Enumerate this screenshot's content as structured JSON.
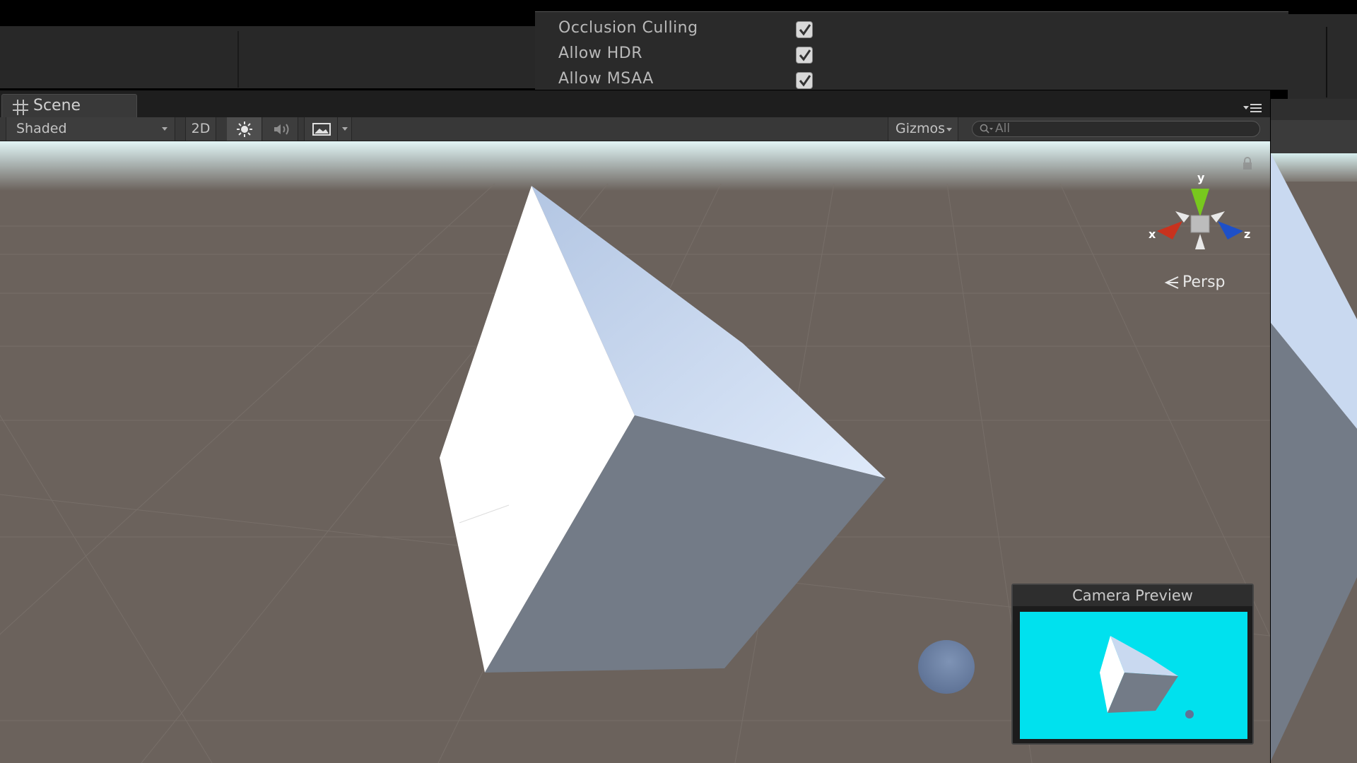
{
  "camera_settings": {
    "rows": [
      {
        "label": "Occlusion Culling",
        "checked": true
      },
      {
        "label": "Allow HDR",
        "checked": true
      },
      {
        "label": "Allow MSAA",
        "checked": true
      }
    ]
  },
  "scene_window": {
    "tab_label": "Scene",
    "toolbar": {
      "shading_mode": "Shaded",
      "toggle_2d": "2D",
      "lighting_on": true,
      "gizmos_label": "Gizmos",
      "search_placeholder": "All"
    },
    "view": {
      "projection_label": "Persp",
      "axis_labels": {
        "x": "x",
        "y": "y",
        "z": "z"
      }
    },
    "camera_preview": {
      "title": "Camera Preview",
      "background_color": "#00e1ee"
    }
  },
  "colors": {
    "editor_dark": "#282828",
    "toolbar": "#383838",
    "ground": "#6b625c",
    "cube_lit": "#ffffff",
    "cube_top": "#c9d9f0",
    "cube_shadow": "#737b87",
    "axis_x": "#c8321e",
    "axis_y": "#78c81e",
    "axis_z": "#1e50c8"
  }
}
